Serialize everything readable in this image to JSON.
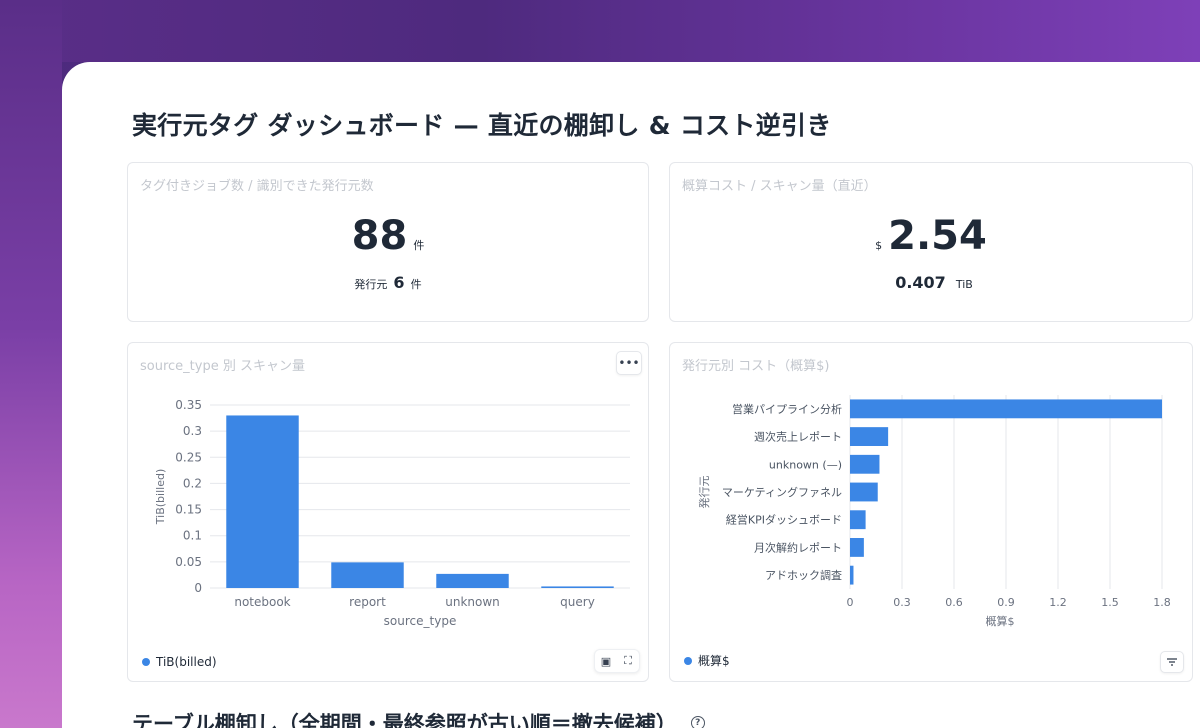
{
  "page": {
    "title": "実行元タグ ダッシュボード — 直近の棚卸し & コスト逆引き",
    "section2_title": "テーブル棚卸し（全期間・最終参照が古い順＝撤去候補）"
  },
  "kpi_jobs": {
    "title": "タグ付きジョブ数 / 識別できた発行元数",
    "value": "88",
    "unit": "件",
    "sub_label": "発行元",
    "sub_value": "6",
    "sub_unit": "件"
  },
  "kpi_cost": {
    "title": "概算コスト / スキャン量（直近）",
    "prefix": "$",
    "value": "2.54",
    "sub_value": "0.407",
    "sub_unit": "TiB"
  },
  "chart_source": {
    "title": "source_type 別 スキャン量",
    "menu_icon": "ellipsis-icon",
    "legend": "TiB(billed)",
    "actions": [
      "image-icon",
      "fullscreen-icon"
    ]
  },
  "chart_issuer": {
    "title": "発行元別 コスト（概算$)",
    "legend": "概算$",
    "filter_icon": "filter-icon"
  },
  "colors": {
    "bar": "#3b86e5",
    "grid": "#e5e7eb"
  },
  "chart_data": [
    {
      "type": "bar",
      "title": "source_type 別 スキャン量",
      "xlabel": "source_type",
      "ylabel": "TiB(billed)",
      "categories": [
        "notebook",
        "report",
        "unknown",
        "query"
      ],
      "series": [
        {
          "name": "TiB(billed)",
          "values": [
            0.33,
            0.049,
            0.027,
            0.003
          ]
        }
      ],
      "ylim": [
        0,
        0.35
      ],
      "yticks": [
        "0",
        "0.05",
        "0.1",
        "0.15",
        "0.2",
        "0.25",
        "0.3",
        "0.35"
      ],
      "grid": true,
      "legend": "bottom-left"
    },
    {
      "type": "bar",
      "orientation": "horizontal",
      "title": "発行元別 コスト（概算$)",
      "xlabel": "概算$",
      "ylabel": "発行元",
      "categories": [
        "営業パイプライン分析",
        "週次売上レポート",
        "unknown (—)",
        "マーケティングファネル",
        "経営KPIダッシュボード",
        "月次解約レポート",
        "アドホック調査"
      ],
      "series": [
        {
          "name": "概算$",
          "values": [
            1.8,
            0.22,
            0.17,
            0.16,
            0.09,
            0.08,
            0.02
          ]
        }
      ],
      "xlim": [
        0,
        1.8
      ],
      "xticks": [
        "0",
        "0.3",
        "0.6",
        "0.9",
        "1.2",
        "1.5",
        "1.8"
      ],
      "grid": true,
      "legend": "bottom-left"
    }
  ]
}
